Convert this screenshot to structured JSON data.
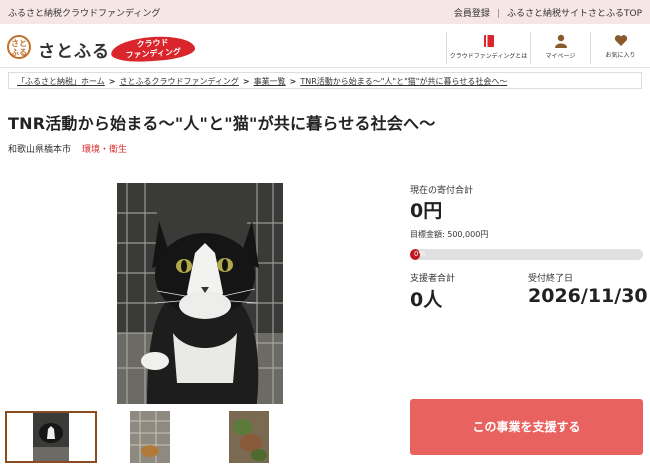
{
  "topbar": {
    "tagline": "ふるさと納税クラウドファンディング",
    "links": [
      "会員登録",
      "ふるさと納税サイトさとふるTOP"
    ]
  },
  "header": {
    "logo_mark": "さと\nふる",
    "logo_text": "さとふる",
    "badge_line1": "クラウド",
    "badge_line2": "ファンディング",
    "nav": [
      {
        "label": "クラウドファンディングとは",
        "icon": "book-icon"
      },
      {
        "label": "マイページ",
        "icon": "person-icon"
      },
      {
        "label": "お気に入り",
        "icon": "heart-icon"
      }
    ]
  },
  "breadcrumb": [
    "「ふるさと納税」ホーム",
    "さとふるクラウドファンディング",
    "事業一覧",
    "TNR活動から始まる～\"人\"と\"猫\"が共に暮らせる社会へ～"
  ],
  "project": {
    "title": "TNR活動から始まる～\"人\"と\"猫\"が共に暮らせる社会へ～",
    "location": "和歌山県橋本市",
    "category": "環境・衛生"
  },
  "stats": {
    "raised_label": "現在の寄付合計",
    "raised_value": "0円",
    "target_text": "目標金額: 500,000円",
    "progress_text": "0%",
    "progress_fraction": 0.0,
    "supporters_label": "支援者合計",
    "supporters_value": "0人",
    "deadline_label": "受付終了日",
    "deadline_value": "2026/11/30"
  },
  "cta": {
    "support_label": "この事業を支援する"
  },
  "colors": {
    "topbar_bg": "#f7e6e6",
    "accent_red": "#d9252b",
    "cta_bg": "#e8625f",
    "logo_brown": "#c1702a"
  }
}
